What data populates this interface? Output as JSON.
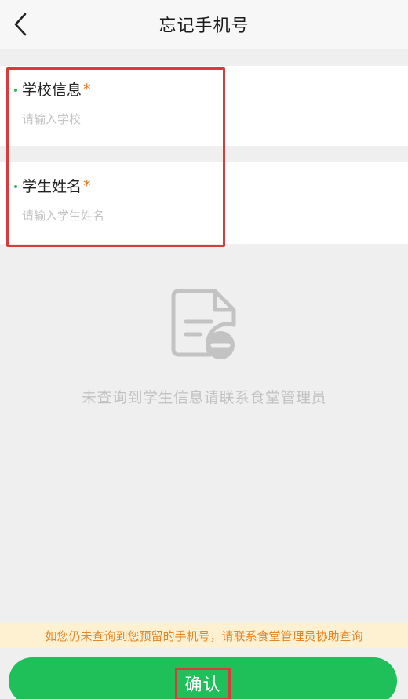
{
  "header": {
    "title": "忘记手机号",
    "back_icon": "chevron-left-icon"
  },
  "form": {
    "school": {
      "label": "学校信息",
      "required_mark": "*",
      "placeholder": "请输入学校",
      "value": ""
    },
    "student_name": {
      "label": "学生姓名",
      "required_mark": "*",
      "placeholder": "请输入学生姓名",
      "value": ""
    }
  },
  "empty_state": {
    "icon": "document-minus-icon",
    "message": "未查询到学生信息请联系食堂管理员"
  },
  "notice": {
    "text": "如您仍未查询到您预留的手机号，请联系食堂管理员协助查询"
  },
  "confirm": {
    "label": "确认"
  },
  "colors": {
    "accent_green": "#1fbf59",
    "required_orange": "#e0761c",
    "notice_text": "#e3862a",
    "notice_bg": "#fdf1d2",
    "highlight_red": "#d93a3a"
  }
}
